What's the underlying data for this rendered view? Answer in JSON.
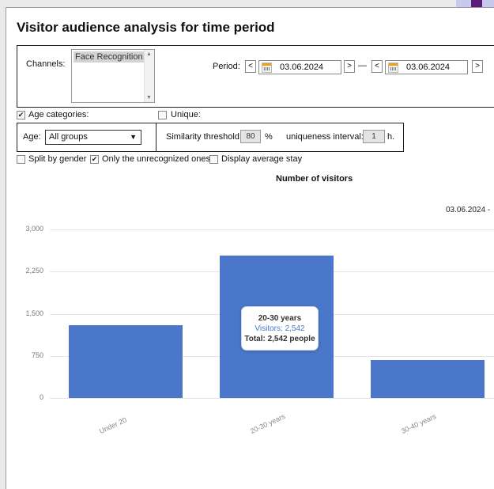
{
  "page": {
    "title": "Visitor audience analysis for time period"
  },
  "channels": {
    "label": "Channels:",
    "selected": "Face Recognition"
  },
  "period": {
    "label": "Period:",
    "prev_label": "<",
    "next_label": ">",
    "start_date": "03.06.2024",
    "separator": "—",
    "end_date": "03.06.2024"
  },
  "options": {
    "age_categories": {
      "label": "Age categories:",
      "checked": true
    },
    "unique": {
      "label": "Unique:",
      "checked": false
    },
    "age": {
      "label": "Age:",
      "value": "All groups"
    },
    "similarity": {
      "label": "Similarity threshold:",
      "value": "80",
      "unit": "%"
    },
    "uniqueness": {
      "label": "uniqueness interval:",
      "value": "1",
      "unit": "h."
    },
    "split_by_gender": {
      "label": "Split by gender",
      "checked": false
    },
    "only_unrecognized": {
      "label": "Only the unrecognized ones",
      "checked": true
    },
    "display_average_stay": {
      "label": "Display average stay",
      "checked": false
    }
  },
  "chart_data": {
    "type": "bar",
    "title": "Number of visitors",
    "subtitle": "03.06.2024 -",
    "categories": [
      "Under 20",
      "20-30 years",
      "30-40 years"
    ],
    "series": [
      {
        "name": "Visitors",
        "values": [
          1290,
          2542,
          680
        ]
      }
    ],
    "ylim": [
      0,
      3000
    ],
    "yticks": [
      "0",
      "750",
      "1,500",
      "2,250",
      "3,000"
    ],
    "grid": true,
    "bar_color": "#4a77c9",
    "tooltip": {
      "title": "20-30 years",
      "line1": "Visitors: 2,542",
      "line2": "Total: 2,542 people"
    }
  }
}
